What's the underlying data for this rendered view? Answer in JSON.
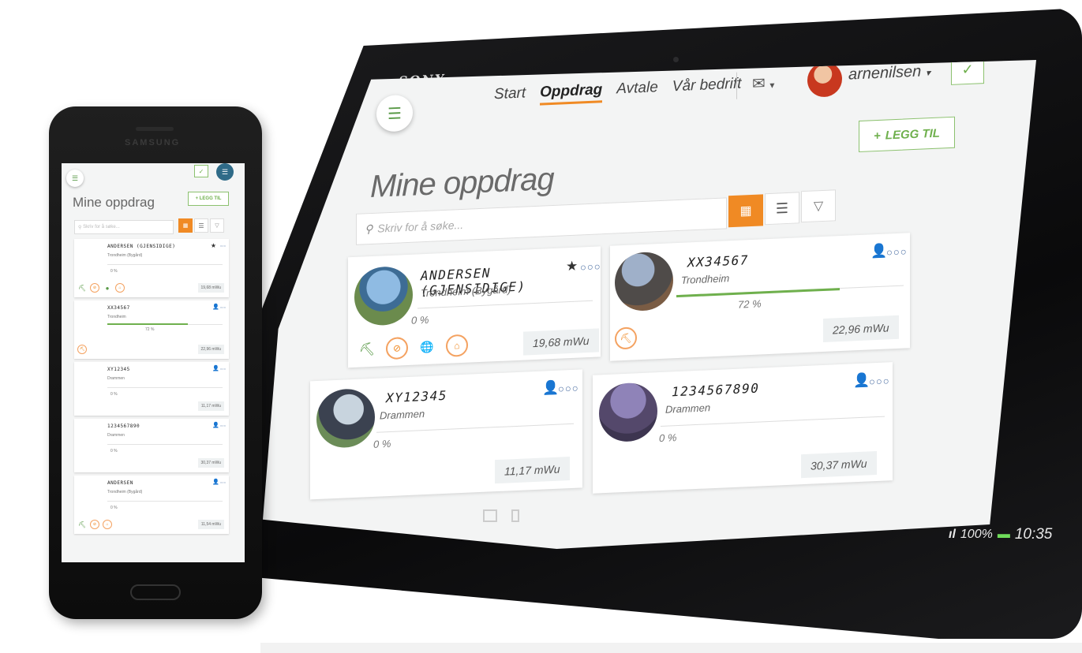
{
  "tablet": {
    "brand": "SONY",
    "nav": [
      "Start",
      "Oppdrag",
      "Avtale",
      "Vår bedrift"
    ],
    "username": "arnenilsen",
    "page_title": "Mine oppdrag",
    "add_label": "LEGG TIL",
    "search_placeholder": "Skriv for å søke...",
    "cards": [
      {
        "title": "ANDERSEN (GJENSIDIGE)",
        "location": "Trondheim (Bygård)",
        "percent": "0 %",
        "mwu": "19,68 mWu"
      },
      {
        "title": "XX34567",
        "location": "Trondheim",
        "percent": "72 %",
        "mwu": "22,96 mWu",
        "progress": 0.72
      },
      {
        "title": "XY12345",
        "location": "Drammen",
        "percent": "0 %",
        "mwu": "11,17 mWu"
      },
      {
        "title": "1234567890",
        "location": "Drammen",
        "percent": "0 %",
        "mwu": "30,37 mWu"
      }
    ],
    "status": {
      "signal": "100%",
      "time": "10:35"
    }
  },
  "phone": {
    "brand": "SAMSUNG",
    "page_title": "Mine oppdrag",
    "add_label": "LEGG TIL",
    "search_placeholder": "Skriv for å søke...",
    "cards": [
      {
        "title": "ANDERSEN (GJENSIDIGE)",
        "location": "Trondheim (Bygård)",
        "percent": "0 %",
        "mwu": "19,68 mWu"
      },
      {
        "title": "XX34567",
        "location": "Trondheim",
        "percent": "72 %",
        "mwu": "22,96 mWu",
        "progress": 0.72
      },
      {
        "title": "XY12345",
        "location": "Drammen",
        "percent": "0 %",
        "mwu": "11,17 mWu"
      },
      {
        "title": "1234567890",
        "location": "Drammen",
        "percent": "0 %",
        "mwu": "30,37 mWu"
      },
      {
        "title": "ANDERSEN",
        "location": "Trondheim (Bygård)",
        "percent": "0 %",
        "mwu": "11,54 mWu"
      }
    ]
  },
  "colors": {
    "accent_orange": "#f08a24",
    "accent_green": "#6fb04d",
    "link_blue": "#4c6fa3"
  }
}
